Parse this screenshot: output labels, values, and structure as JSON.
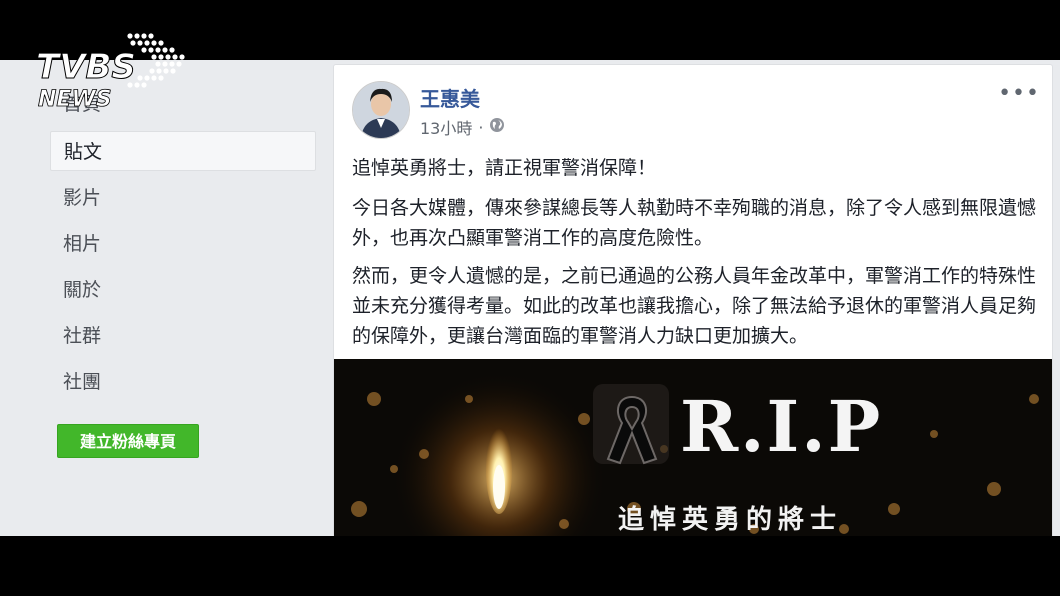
{
  "logo": {
    "top_text": "TVBS",
    "bottom_text": "NEWS"
  },
  "sidebar": {
    "items": [
      {
        "label": "首頁"
      },
      {
        "label": "貼文"
      },
      {
        "label": "影片"
      },
      {
        "label": "相片"
      },
      {
        "label": "關於"
      },
      {
        "label": "社群"
      },
      {
        "label": "社團"
      }
    ],
    "active_index": 1,
    "create_page_label": "建立粉絲專頁"
  },
  "post": {
    "author": "王惠美",
    "timestamp": "13小時",
    "separator": "·",
    "headline": "追悼英勇將士，請正視軍警消保障！",
    "paragraphs": [
      "今日各大媒體，傳來參謀總長等人執勤時不幸殉職的消息，除了令人感到無限遺憾外，也再次凸顯軍警消工作的高度危險性。",
      "然而，更令人遺憾的是，之前已通過的公務人員年金改革中，軍警消工作的特殊性並未充分獲得考量。如此的改革也讓我擔心，除了無法給予退休的軍警消人員足夠的保障外，更讓台灣面臨的軍警消人力缺口更加擴大。"
    ],
    "more_label": "•••",
    "image": {
      "rip": "R.I.P",
      "caption": "追悼英勇的將士"
    }
  },
  "colors": {
    "link": "#365899",
    "green": "#42b72a",
    "bg": "#e9ebee"
  }
}
